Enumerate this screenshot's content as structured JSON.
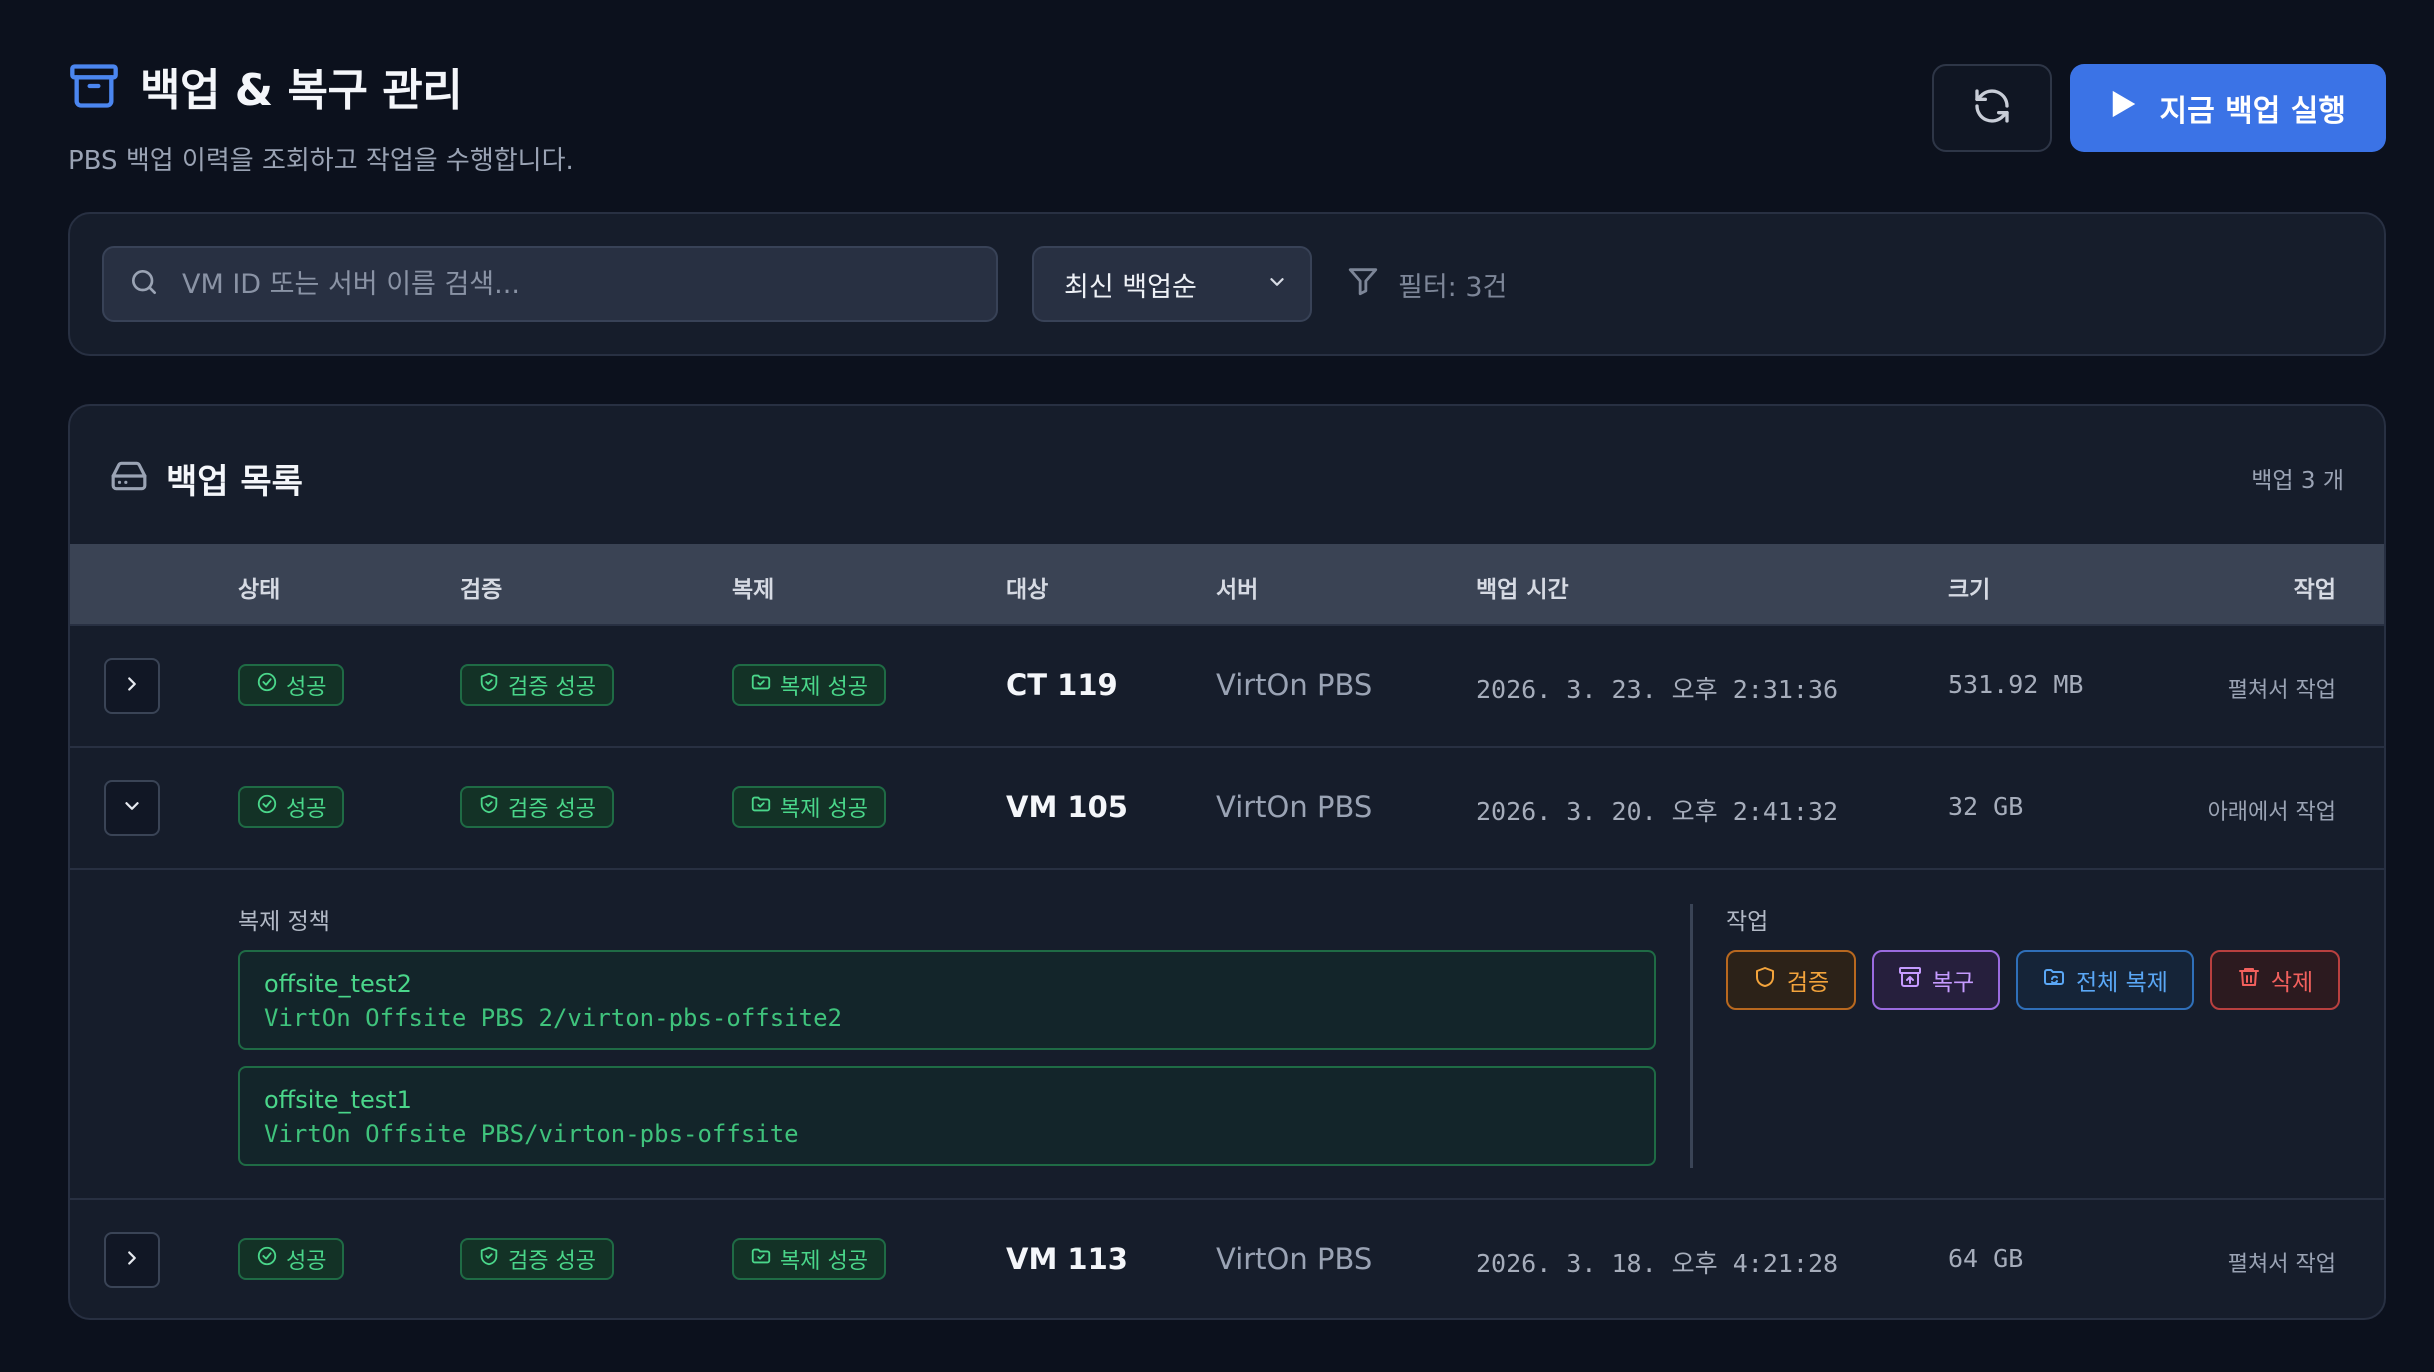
{
  "header": {
    "title": "백업 & 복구 관리",
    "subtitle": "PBS 백업 이력을 조회하고 작업을 수행합니다.",
    "run_label": "지금 백업 실행"
  },
  "filters": {
    "search_placeholder": "VM ID 또는 서버 이름 검색...",
    "sort_value": "최신 백업순",
    "filter_info": "필터: 3건"
  },
  "list": {
    "title": "백업 목록",
    "count": "백업 3 개",
    "columns": {
      "status": "상태",
      "verify": "검증",
      "replicate": "복제",
      "target": "대상",
      "server": "서버",
      "time": "백업 시간",
      "size": "크기",
      "action": "작업"
    },
    "rows": [
      {
        "status": "성공",
        "verify": "검증 성공",
        "replicate": "복제 성공",
        "target": "CT 119",
        "server": "VirtOn PBS",
        "time": "2026. 3. 23. 오후 2:31:36",
        "size": "531.92 MB",
        "action": "펼쳐서 작업"
      },
      {
        "status": "성공",
        "verify": "검증 성공",
        "replicate": "복제 성공",
        "target": "VM 105",
        "server": "VirtOn PBS",
        "time": "2026. 3. 20. 오후 2:41:32",
        "size": "32 GB",
        "action": "아래에서 작업"
      },
      {
        "status": "성공",
        "verify": "검증 성공",
        "replicate": "복제 성공",
        "target": "VM 113",
        "server": "VirtOn PBS",
        "time": "2026. 3. 18. 오후 4:21:28",
        "size": "64 GB",
        "action": "펼쳐서 작업"
      }
    ],
    "detail": {
      "policy_label": "복제 정책",
      "policies": [
        {
          "name": "offsite_test2",
          "path": "VirtOn Offsite PBS 2/virton-pbs-offsite2"
        },
        {
          "name": "offsite_test1",
          "path": "VirtOn Offsite PBS/virton-pbs-offsite"
        }
      ],
      "ops_label": "작업",
      "ops": {
        "verify": "검증",
        "restore": "복구",
        "replicate_all": "전체 복제",
        "delete": "삭제"
      }
    }
  },
  "icons": {
    "title": "archive-box-icon",
    "refresh": "refresh-icon",
    "run": "play-icon",
    "search": "search-icon",
    "sort": "chevron-down-icon",
    "filter": "funnel-icon",
    "list": "hard-drive-icon"
  },
  "colors": {
    "accent": "#3b73e6",
    "success": "#4ad68a",
    "verify": "#f3a43c",
    "restore": "#c59bff",
    "replicate": "#5aa7f5",
    "delete": "#f2605d"
  }
}
